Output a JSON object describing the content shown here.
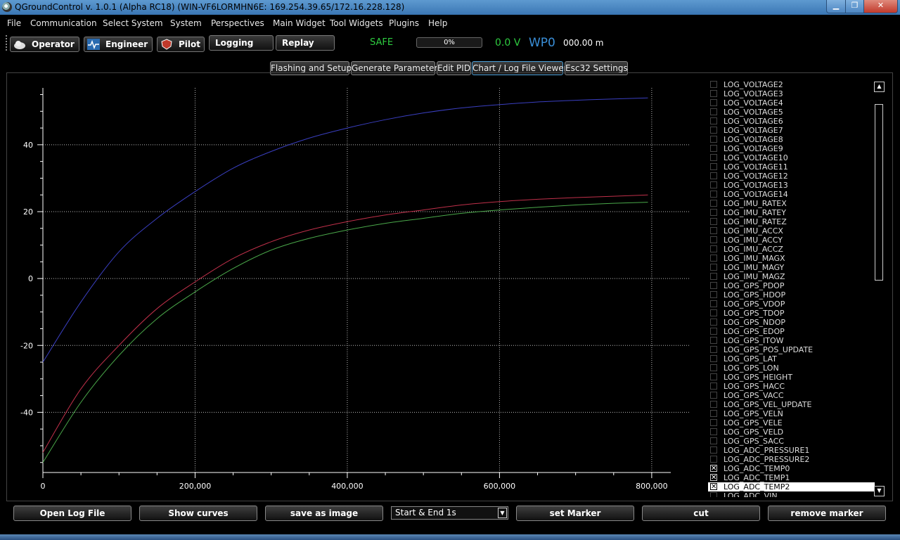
{
  "window": {
    "title": "QGroundControl v. 1.0.1 (Alpha RC18) (WIN-VF6LORMHN6E: 169.254.39.65/172.16.228.128)"
  },
  "menu": [
    "File",
    "Communication",
    "Select System",
    "System",
    "Perspectives",
    "Main Widget",
    "Tool Widgets",
    "Plugins",
    "Help"
  ],
  "toolbar": {
    "perspectives": [
      "Operator",
      "Engineer",
      "Pilot",
      "Logging",
      "Replay"
    ],
    "status": "SAFE",
    "battery_percent_label": "0%",
    "battery_fraction": 0,
    "voltage": "0.0 V",
    "waypoint": "WP0",
    "altitude": "000.00 m"
  },
  "tabs": [
    "Flashing and Setup",
    "Generate Parameter",
    "Edit PID",
    "Chart / Log File Viewer",
    "Esc32 Settings"
  ],
  "active_tab": "Chart / Log File Viewer",
  "colors": {
    "accent": "#4a9fd8",
    "status_ok": "#2ecc40",
    "series_blue": "#3a3fc0",
    "series_red": "#c0304a",
    "series_green": "#4aa84a"
  },
  "curves": [
    {
      "name": "LOG_VOLTAGE2",
      "checked": false
    },
    {
      "name": "LOG_VOLTAGE3",
      "checked": false
    },
    {
      "name": "LOG_VOLTAGE4",
      "checked": false
    },
    {
      "name": "LOG_VOLTAGE5",
      "checked": false
    },
    {
      "name": "LOG_VOLTAGE6",
      "checked": false
    },
    {
      "name": "LOG_VOLTAGE7",
      "checked": false
    },
    {
      "name": "LOG_VOLTAGE8",
      "checked": false
    },
    {
      "name": "LOG_VOLTAGE9",
      "checked": false
    },
    {
      "name": "LOG_VOLTAGE10",
      "checked": false
    },
    {
      "name": "LOG_VOLTAGE11",
      "checked": false
    },
    {
      "name": "LOG_VOLTAGE12",
      "checked": false
    },
    {
      "name": "LOG_VOLTAGE13",
      "checked": false
    },
    {
      "name": "LOG_VOLTAGE14",
      "checked": false
    },
    {
      "name": "LOG_IMU_RATEX",
      "checked": false
    },
    {
      "name": "LOG_IMU_RATEY",
      "checked": false
    },
    {
      "name": "LOG_IMU_RATEZ",
      "checked": false
    },
    {
      "name": "LOG_IMU_ACCX",
      "checked": false
    },
    {
      "name": "LOG_IMU_ACCY",
      "checked": false
    },
    {
      "name": "LOG_IMU_ACCZ",
      "checked": false
    },
    {
      "name": "LOG_IMU_MAGX",
      "checked": false
    },
    {
      "name": "LOG_IMU_MAGY",
      "checked": false
    },
    {
      "name": "LOG_IMU_MAGZ",
      "checked": false
    },
    {
      "name": "LOG_GPS_PDOP",
      "checked": false
    },
    {
      "name": "LOG_GPS_HDOP",
      "checked": false
    },
    {
      "name": "LOG_GPS_VDOP",
      "checked": false
    },
    {
      "name": "LOG_GPS_TDOP",
      "checked": false
    },
    {
      "name": "LOG_GPS_NDOP",
      "checked": false
    },
    {
      "name": "LOG_GPS_EDOP",
      "checked": false
    },
    {
      "name": "LOG_GPS_ITOW",
      "checked": false
    },
    {
      "name": "LOG_GPS_POS_UPDATE",
      "checked": false
    },
    {
      "name": "LOG_GPS_LAT",
      "checked": false
    },
    {
      "name": "LOG_GPS_LON",
      "checked": false
    },
    {
      "name": "LOG_GPS_HEIGHT",
      "checked": false
    },
    {
      "name": "LOG_GPS_HACC",
      "checked": false
    },
    {
      "name": "LOG_GPS_VACC",
      "checked": false
    },
    {
      "name": "LOG_GPS_VEL_UPDATE",
      "checked": false
    },
    {
      "name": "LOG_GPS_VELN",
      "checked": false
    },
    {
      "name": "LOG_GPS_VELE",
      "checked": false
    },
    {
      "name": "LOG_GPS_VELD",
      "checked": false
    },
    {
      "name": "LOG_GPS_SACC",
      "checked": false
    },
    {
      "name": "LOG_ADC_PRESSURE1",
      "checked": false
    },
    {
      "name": "LOG_ADC_PRESSURE2",
      "checked": false
    },
    {
      "name": "LOG_ADC_TEMP0",
      "checked": true
    },
    {
      "name": "LOG_ADC_TEMP1",
      "checked": true
    },
    {
      "name": "LOG_ADC_TEMP2",
      "checked": true,
      "selected": true
    },
    {
      "name": "LOG_ADC_VIN",
      "checked": false
    }
  ],
  "chart_data": {
    "type": "line",
    "xlim": [
      0,
      850000
    ],
    "ylim": [
      -58,
      57
    ],
    "x_ticks": [
      0,
      200000,
      400000,
      600000,
      800000
    ],
    "x_tick_labels": [
      "0",
      "200,000",
      "400,000",
      "600,000",
      "800,000"
    ],
    "y_ticks": [
      -40,
      -20,
      0,
      20,
      40
    ],
    "y_tick_labels": [
      "-40",
      "-20",
      "0",
      "20",
      "40"
    ],
    "grid": true,
    "series": [
      {
        "color": "#3a3fc0",
        "x": [
          0,
          50000,
          100000,
          150000,
          200000,
          250000,
          300000,
          350000,
          400000,
          450000,
          500000,
          550000,
          600000,
          650000,
          700000,
          750000,
          795000
        ],
        "y": [
          -25,
          -7,
          8,
          18,
          26,
          33,
          38,
          42,
          45,
          47.5,
          49.5,
          51,
          52,
          52.8,
          53.3,
          53.7,
          54
        ]
      },
      {
        "color": "#c0304a",
        "x": [
          0,
          50000,
          100000,
          150000,
          200000,
          250000,
          300000,
          350000,
          400000,
          450000,
          500000,
          550000,
          600000,
          650000,
          700000,
          750000,
          795000
        ],
        "y": [
          -52,
          -33,
          -20,
          -9,
          -1,
          6,
          11,
          14.5,
          17,
          19,
          20.5,
          22,
          23,
          23.7,
          24.2,
          24.6,
          25
        ]
      },
      {
        "color": "#4aa84a",
        "x": [
          0,
          50000,
          100000,
          150000,
          200000,
          250000,
          300000,
          350000,
          400000,
          450000,
          500000,
          550000,
          600000,
          650000,
          700000,
          750000,
          795000
        ],
        "y": [
          -55,
          -37,
          -23,
          -12,
          -4,
          3,
          8.5,
          12,
          14.5,
          16.5,
          18,
          19.5,
          20.5,
          21.3,
          22,
          22.5,
          22.8
        ]
      }
    ]
  },
  "bottom": {
    "open_log": "Open Log File",
    "show_curves": "Show curves",
    "save_image": "save as image",
    "combo_value": "Start & End 1s",
    "set_marker": "set Marker",
    "cut": "cut",
    "remove_marker": "remove marker"
  }
}
